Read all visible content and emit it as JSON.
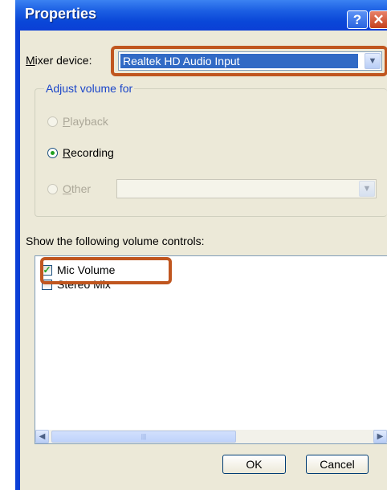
{
  "window": {
    "title": "Properties",
    "help_glyph": "?",
    "close_glyph": "✕"
  },
  "mixer": {
    "label_first": "M",
    "label_rest": "ixer device:",
    "value": "Realtek HD Audio Input",
    "dropdown_glyph": "▼"
  },
  "adjust_group": {
    "title": "Adjust volume for",
    "options": [
      {
        "underline": "P",
        "rest": "layback",
        "selected": false,
        "enabled": false
      },
      {
        "underline": "R",
        "rest": "ecording",
        "selected": true,
        "enabled": true
      },
      {
        "underline": "O",
        "rest": "ther",
        "selected": false,
        "enabled": false
      }
    ],
    "other_dropdown_glyph": "▼"
  },
  "controls": {
    "label": "Show the following volume controls:",
    "items": [
      {
        "label": "Mic Volume",
        "checked": true,
        "check_glyph": "✓"
      },
      {
        "label": "Stereo Mix",
        "checked": false,
        "check_glyph": ""
      }
    ],
    "scroll_left_glyph": "◀",
    "scroll_right_glyph": "▶",
    "scroll_thumb_grip": "|||"
  },
  "buttons": {
    "ok": "OK",
    "cancel": "Cancel"
  },
  "colors": {
    "callout": "#c0561f",
    "title_bar": "#0b3fd6",
    "selection": "#316ac5",
    "check": "#21a121"
  }
}
